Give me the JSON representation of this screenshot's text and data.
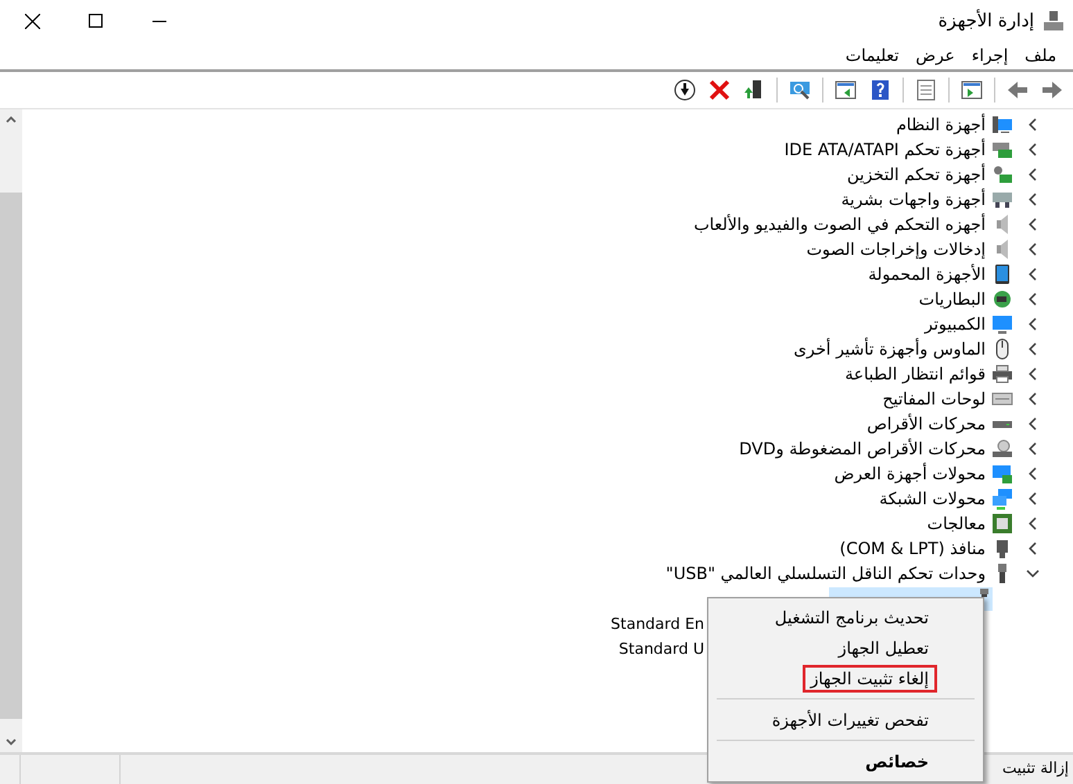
{
  "window": {
    "title": "إدارة الأجهزة"
  },
  "menu": [
    "ملف",
    "إجراء",
    "عرض",
    "تعليمات"
  ],
  "tree": [
    {
      "label": "أجهزة النظام",
      "expanded": false
    },
    {
      "label": "أجهزة تحكم IDE ATA/ATAPI",
      "expanded": false
    },
    {
      "label": "أجهزة تحكم التخزين",
      "expanded": false
    },
    {
      "label": "أجهزة واجهات بشرية",
      "expanded": false
    },
    {
      "label": "أجهزه التحكم في الصوت والفيديو والألعاب",
      "expanded": false
    },
    {
      "label": "إدخالات وإخراجات الصوت",
      "expanded": false
    },
    {
      "label": "الأجهزة المحمولة",
      "expanded": false
    },
    {
      "label": "البطاريات",
      "expanded": false
    },
    {
      "label": "الكمبيوتر",
      "expanded": false
    },
    {
      "label": "الماوس وأجهزة تأشير أخرى",
      "expanded": false
    },
    {
      "label": "قوائم انتظار الطباعة",
      "expanded": false
    },
    {
      "label": "لوحات المفاتيح",
      "expanded": false
    },
    {
      "label": "محركات الأقراص",
      "expanded": false
    },
    {
      "label": "محركات الأقراص المضغوطة وDVD",
      "expanded": false
    },
    {
      "label": "محولات أجهزة العرض",
      "expanded": false
    },
    {
      "label": "محولات الشبكة",
      "expanded": false
    },
    {
      "label": "معالجات",
      "expanded": false
    },
    {
      "label": "منافذ (COM & LPT)",
      "expanded": false
    },
    {
      "label": "وحدات تحكم الناقل التسلسلي العالمي \"USB\"",
      "expanded": true,
      "children": [
        {
          "selected": true
        },
        {
          "label": "Standard En",
          "selected": false
        },
        {
          "label": "Standard U",
          "selected": false
        }
      ]
    }
  ],
  "context_menu": [
    {
      "kind": "item",
      "label": "تحديث برنامج التشغيل",
      "highlighted": false,
      "default": false
    },
    {
      "kind": "item",
      "label": "تعطيل الجهاز",
      "highlighted": false,
      "default": false
    },
    {
      "kind": "item",
      "label": "إلغاء تثبيت الجهاز",
      "highlighted": true,
      "default": false
    },
    {
      "kind": "separator"
    },
    {
      "kind": "item",
      "label": "تفحص تغييرات الأجهزة",
      "highlighted": false,
      "default": false
    },
    {
      "kind": "separator"
    },
    {
      "kind": "item",
      "label": "خصائص",
      "highlighted": false,
      "default": true
    }
  ],
  "status_bar": "إزالة تثبيت"
}
